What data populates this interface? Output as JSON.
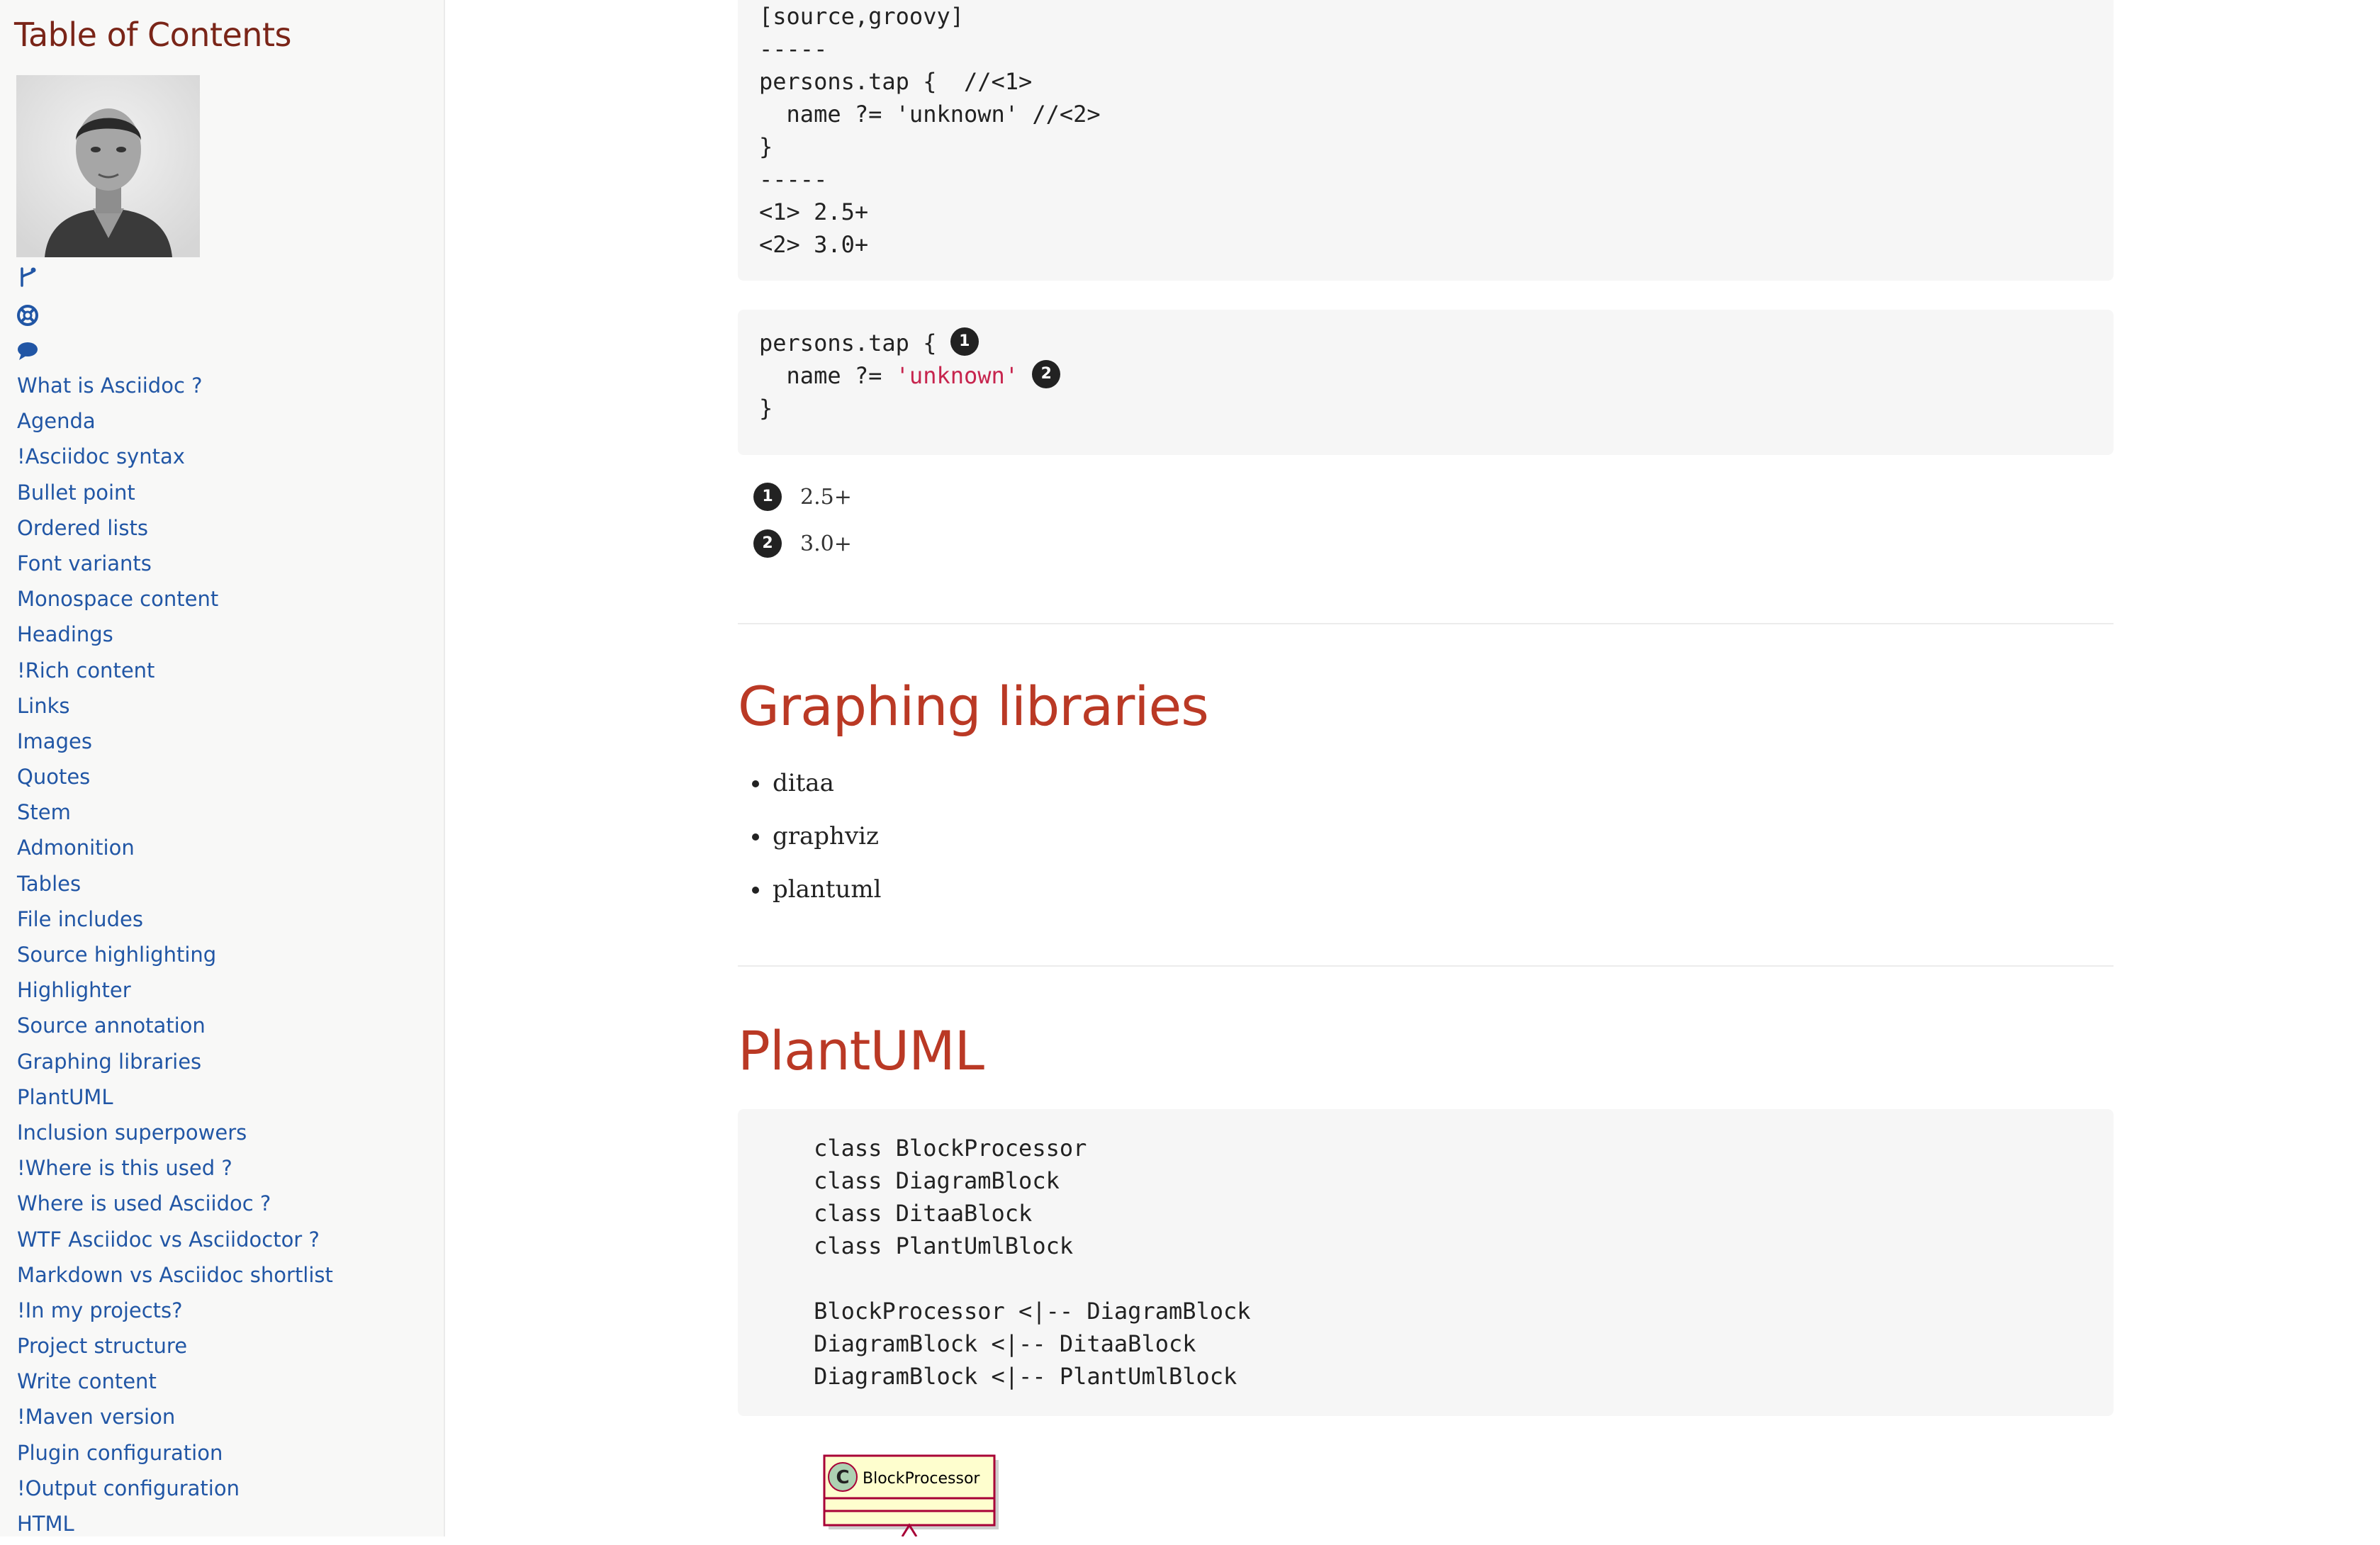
{
  "sidebar": {
    "toc_title": "Table of Contents",
    "icons": [
      "git-branch-icon",
      "life-ring-icon",
      "comment-icon"
    ],
    "items": [
      "What is Asciidoc ?",
      "Agenda",
      "!Asciidoc syntax",
      "Bullet point",
      "Ordered lists",
      "Font variants",
      "Monospace content",
      "Headings",
      "!Rich content",
      "Links",
      "Images",
      "Quotes",
      "Stem",
      "Admonition",
      "Tables",
      "File includes",
      "Source highlighting",
      "Highlighter",
      "Source annotation",
      "Graphing libraries",
      "PlantUML",
      "Inclusion superpowers",
      "!Where is this used ?",
      "Where is used Asciidoc ?",
      "WTF Asciidoc vs Asciidoctor ?",
      "Markdown vs Asciidoc shortlist",
      "!In my projects?",
      "Project structure",
      "Write content",
      "!Maven version",
      "Plugin configuration",
      "!Output configuration",
      "HTML"
    ]
  },
  "listing_raw": {
    "lines": [
      "[source,groovy]",
      "-----",
      "persons.tap {  //<1>",
      "  name ?= 'unknown' //<2>",
      "}",
      "-----",
      "<1> 2.5+",
      "<2> 3.0+"
    ]
  },
  "listing_annotated": {
    "line1": "persons.tap { ",
    "line2_code": "  name ?= ",
    "line2_string": "'unknown'",
    "line3": "}",
    "callout1": "1",
    "callout2": "2"
  },
  "callouts": [
    {
      "num": "1",
      "text": "2.5+"
    },
    {
      "num": "2",
      "text": "3.0+"
    }
  ],
  "graphing": {
    "title": "Graphing libraries",
    "items": [
      "ditaa",
      "graphviz",
      "plantuml"
    ]
  },
  "plantuml": {
    "title": "PlantUML",
    "lines": [
      "    class BlockProcessor",
      "    class DiagramBlock",
      "    class DitaaBlock",
      "    class PlantUmlBlock",
      "",
      "    BlockProcessor <|-- DiagramBlock",
      "    DiagramBlock <|-- DitaaBlock",
      "    DiagramBlock <|-- PlantUmlBlock"
    ],
    "diagram": {
      "class_name": "BlockProcessor",
      "stereotype_letter": "C",
      "class_fill": "#fefece",
      "class_border": "#a80036",
      "circle_fill": "#add1b2"
    }
  },
  "colors": {
    "link": "#2156a5",
    "toc_title": "#7a2518",
    "section_title": "#ba3925",
    "string": "#c7254e"
  }
}
